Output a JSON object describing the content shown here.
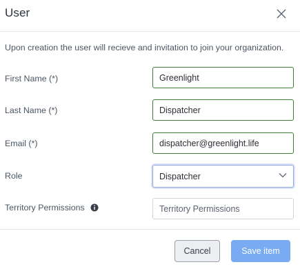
{
  "dialog": {
    "title": "User",
    "close_icon": "close-icon",
    "intro": "Upon creation the user will recieve and invitation to join your organization."
  },
  "form": {
    "first_name": {
      "label": "First Name (*)",
      "value": "Greenlight"
    },
    "last_name": {
      "label": "Last Name (*)",
      "value": "Dispatcher"
    },
    "email": {
      "label": "Email (*)",
      "value": "dispatcher@greenlight.life"
    },
    "role": {
      "label": "Role",
      "selected": "Dispatcher",
      "icon": "chevron-down-icon"
    },
    "territory": {
      "label": "Territory Permissions",
      "placeholder": "Territory Permissions",
      "info_icon": "info-icon"
    }
  },
  "footer": {
    "cancel_label": "Cancel",
    "save_label": "Save item"
  },
  "colors": {
    "filled_border": "#3f7d3a",
    "focus_border": "#8fa6de",
    "save_button": "#78abf2"
  }
}
